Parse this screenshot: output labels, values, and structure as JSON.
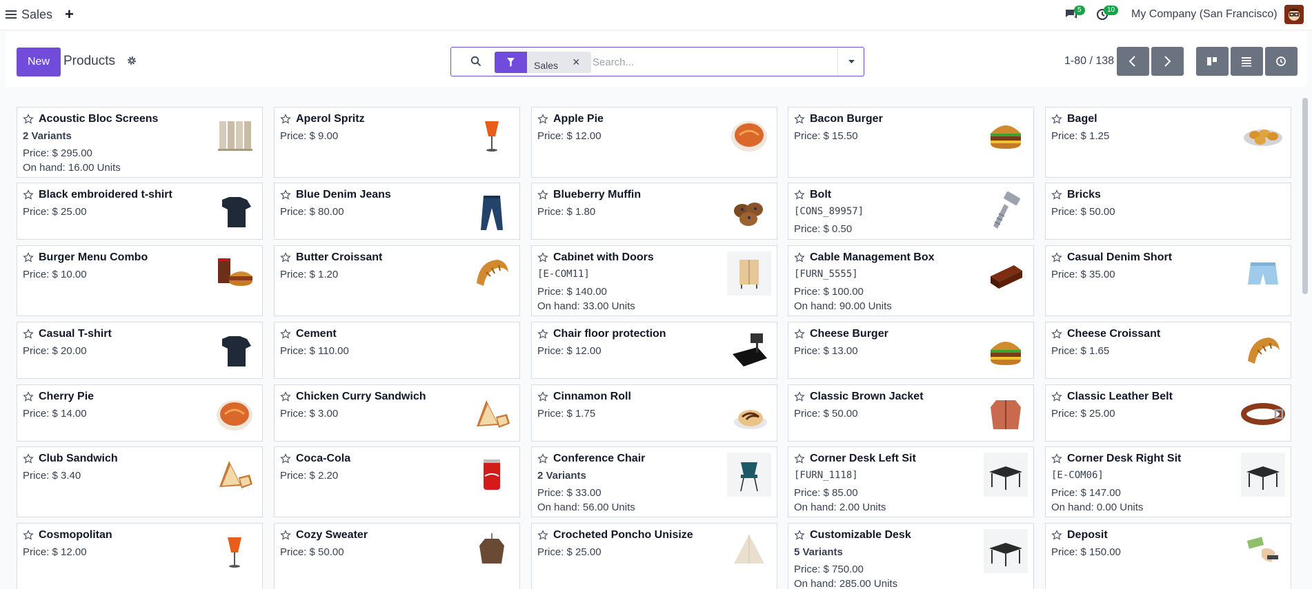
{
  "navbar": {
    "app_name": "Sales",
    "plus": "+",
    "messages_count": "5",
    "activities_count": "10",
    "company": "My Company (San Francisco)"
  },
  "control": {
    "new_label": "New",
    "breadcrumb": "Products",
    "facet_label": "Sales",
    "facet_close": "×",
    "search_placeholder": "Search...",
    "pager": "1-80 / 138"
  },
  "colors": {
    "accent": "#714bd9",
    "badge": "#16a34a",
    "pager_button": "#6b7280"
  },
  "cards": [
    {
      "name": "Acoustic Bloc Screens",
      "variants": "2 Variants",
      "price": "Price: $ 295.00",
      "onhand": "On hand: 16.00 Units",
      "icon": "screen-icon"
    },
    {
      "name": "Aperol Spritz",
      "price": "Price: $ 9.00",
      "icon": "cocktail-icon"
    },
    {
      "name": "Apple Pie",
      "price": "Price: $ 12.00",
      "icon": "pie-icon"
    },
    {
      "name": "Bacon Burger",
      "price": "Price: $ 15.50",
      "icon": "burger-icon"
    },
    {
      "name": "Bagel",
      "price": "Price: $ 1.25",
      "icon": "bagel-icon"
    },
    {
      "name": "Black embroidered t-shirt",
      "price": "Price: $ 25.00",
      "icon": "tshirt-icon"
    },
    {
      "name": "Blue Denim Jeans",
      "price": "Price: $ 80.00",
      "icon": "jeans-icon"
    },
    {
      "name": "Blueberry Muffin",
      "price": "Price: $ 1.80",
      "icon": "muffin-icon"
    },
    {
      "name": "Bolt",
      "ref": "[CONS_89957]",
      "price": "Price: $ 0.50",
      "icon": "bolt-icon"
    },
    {
      "name": "Bricks",
      "price": "Price: $ 50.00"
    },
    {
      "name": "Burger Menu Combo",
      "price": "Price: $ 10.00",
      "icon": "combo-icon"
    },
    {
      "name": "Butter Croissant",
      "price": "Price: $ 1.20",
      "icon": "croissant-icon"
    },
    {
      "name": "Cabinet with Doors",
      "ref": "[E-COM11]",
      "price": "Price: $ 140.00",
      "onhand": "On hand: 33.00 Units",
      "icon": "cabinet-icon"
    },
    {
      "name": "Cable Management Box",
      "ref": "[FURN_5555]",
      "price": "Price: $ 100.00",
      "onhand": "On hand: 90.00 Units",
      "icon": "box-icon"
    },
    {
      "name": "Casual Denim Short",
      "price": "Price: $ 35.00",
      "icon": "shorts-icon"
    },
    {
      "name": "Casual T-shirt",
      "price": "Price: $ 20.00",
      "icon": "tshirt-icon"
    },
    {
      "name": "Cement",
      "price": "Price: $ 110.00"
    },
    {
      "name": "Chair floor protection",
      "price": "Price: $ 12.00",
      "icon": "floor-mat-icon"
    },
    {
      "name": "Cheese Burger",
      "price": "Price: $ 13.00",
      "icon": "burger-icon"
    },
    {
      "name": "Cheese Croissant",
      "price": "Price: $ 1.65",
      "icon": "croissant-icon"
    },
    {
      "name": "Cherry Pie",
      "price": "Price: $ 14.00",
      "icon": "pie-icon"
    },
    {
      "name": "Chicken Curry Sandwich",
      "price": "Price: $ 3.00",
      "icon": "sandwich-icon"
    },
    {
      "name": "Cinnamon Roll",
      "price": "Price: $ 1.75",
      "icon": "roll-icon"
    },
    {
      "name": "Classic Brown Jacket",
      "price": "Price: $ 50.00",
      "icon": "jacket-icon"
    },
    {
      "name": "Classic Leather Belt",
      "price": "Price: $ 25.00",
      "icon": "belt-icon"
    },
    {
      "name": "Club Sandwich",
      "price": "Price: $ 3.40",
      "icon": "sandwich-icon"
    },
    {
      "name": "Coca-Cola",
      "price": "Price: $ 2.20",
      "icon": "can-icon"
    },
    {
      "name": "Conference Chair",
      "variants": "2 Variants",
      "price": "Price: $ 33.00",
      "onhand": "On hand: 56.00 Units",
      "icon": "chair-icon"
    },
    {
      "name": "Corner Desk Left Sit",
      "ref": "[FURN_1118]",
      "price": "Price: $ 85.00",
      "onhand": "On hand: 2.00 Units",
      "icon": "desk-icon"
    },
    {
      "name": "Corner Desk Right Sit",
      "ref": "[E-COM06]",
      "price": "Price: $ 147.00",
      "onhand": "On hand: 0.00 Units",
      "icon": "desk-icon"
    },
    {
      "name": "Cosmopolitan",
      "price": "Price: $ 12.00",
      "icon": "cocktail-icon"
    },
    {
      "name": "Cozy Sweater",
      "price": "Price: $ 50.00",
      "icon": "sweater-icon"
    },
    {
      "name": "Crocheted Poncho Unisize",
      "price": "Price: $ 25.00",
      "icon": "poncho-icon"
    },
    {
      "name": "Customizable Desk",
      "variants": "5 Variants",
      "price": "Price: $ 750.00",
      "onhand": "On hand: 285.00 Units",
      "icon": "desk-icon"
    },
    {
      "name": "Deposit",
      "price": "Price: $ 150.00",
      "icon": "money-icon"
    }
  ]
}
